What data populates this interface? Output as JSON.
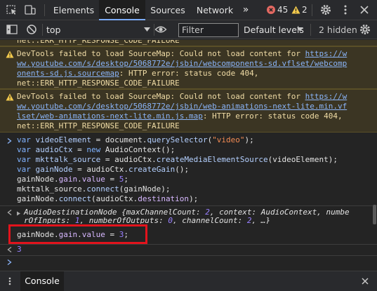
{
  "tabs": {
    "elements": "Elements",
    "console": "Console",
    "sources": "Sources",
    "network": "Network",
    "more": "»"
  },
  "badges": {
    "errors": "45",
    "warnings": "2"
  },
  "toolbar": {
    "context": "top",
    "filter_placeholder": "Filter",
    "levels": "Default levels",
    "hidden": "2 hidden"
  },
  "messages": {
    "warn_prev_tail": "net::ERR_HTTP_RESPONSE_CODE_FAILURE",
    "warn1": {
      "prefix": "DevTools failed to load SourceMap: Could not load content for ",
      "url_a": "https://w",
      "url_b": "ww.youtube.com/s/desktop/5068772e/jsbin/webcomponents-sd.vflset/webcomp",
      "url_c": "onents-sd.js.sourcemap",
      "suffix": ": HTTP error: status code 404,",
      "tail": "net::ERR_HTTP_RESPONSE_CODE_FAILURE"
    },
    "warn2": {
      "prefix": "DevTools failed to load SourceMap: Could not load content for ",
      "url_a": "https://w",
      "url_b": "ww.youtube.com/s/desktop/5068772e/jsbin/web-animations-next-lite.min.vf",
      "url_c": "lset/web-animations-next-lite.min.js.map",
      "suffix": ": HTTP error: status code 404,",
      "tail": "net::ERR_HTTP_RESPONSE_CODE_FAILURE"
    },
    "input_code": {
      "l1_kw": "var ",
      "l1_var": "videoElement",
      "l1_mid": " = document.",
      "l1_fn": "querySelector",
      "l1_open": "(",
      "l1_str": "\"video\"",
      "l1_close": ");",
      "l2_kw": "var ",
      "l2_var": "audioCtx",
      "l2_mid": " = ",
      "l2_new": "new",
      "l2_rest": " AudioContext();",
      "l3_kw": "var ",
      "l3_var": "mkttalk_source",
      "l3_mid": " = audioCtx.",
      "l3_fn": "createMediaElementSource",
      "l3_rest": "(videoElement);",
      "l4_kw": "var ",
      "l4_var": "gainNode",
      "l4_mid": " = audioCtx.",
      "l4_fn": "createGain",
      "l4_rest": "();",
      "l5_a": "gainNode.",
      "l5_prop1": "gain",
      "l5_dot": ".",
      "l5_prop2": "value",
      "l5_eq": " = ",
      "l5_num": "5",
      "l5_end": ";",
      "l6_a": "mkttalk_source.",
      "l6_fn": "connect",
      "l6_rest": "(gainNode);",
      "l7_a": "gainNode.",
      "l7_fn": "connect",
      "l7_mid": "(audioCtx.",
      "l7_prop": "destination",
      "l7_rest": ");"
    },
    "result1": {
      "l1_name": "AudioDestinationNode ",
      "l1_a": "{maxChannelCount: ",
      "l1_n1": "2",
      "l1_b": ", context: AudioContext, numbe",
      "l2_a": "rOfInputs: ",
      "l2_n1": "1",
      "l2_b": ", numberOfOutputs: ",
      "l2_n2": "0",
      "l2_c": ", channelCount: ",
      "l2_n3": "2",
      "l2_d": ", …}"
    },
    "input2": {
      "a": "gainNode.",
      "prop1": "gain",
      "dot": ".",
      "prop2": "value",
      "eq": " = ",
      "num": "3",
      "end": ";"
    },
    "result2": "3"
  },
  "drawer": {
    "tab": "Console"
  },
  "colors": {
    "accent": "#7cacf8",
    "warning_bg": "#3b3523",
    "highlight": "#e2131c"
  }
}
